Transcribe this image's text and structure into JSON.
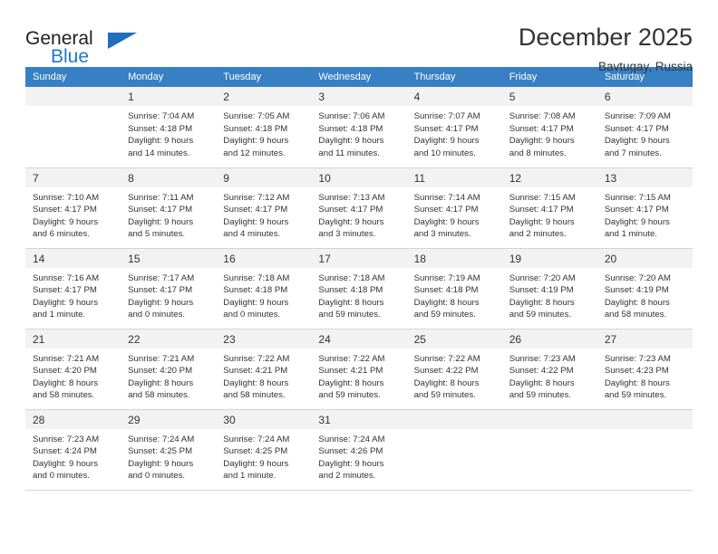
{
  "logo": {
    "text_top": "General",
    "text_bottom": "Blue",
    "flag_icon": "triangle-flag-icon",
    "color_primary": "#2079c7",
    "color_dark": "#231f20"
  },
  "header": {
    "title": "December 2025",
    "subtitle": "Bavtugay, Russia"
  },
  "calendar": {
    "header_bg": "#3880c4",
    "daynum_bg": "#f2f2f2",
    "weekdays": [
      "Sunday",
      "Monday",
      "Tuesday",
      "Wednesday",
      "Thursday",
      "Friday",
      "Saturday"
    ],
    "weeks": [
      [
        {
          "day": "",
          "empty": true,
          "sunrise": "",
          "sunset": "",
          "daylight_line1": "",
          "daylight_line2": ""
        },
        {
          "day": "1",
          "empty": false,
          "sunrise": "Sunrise: 7:04 AM",
          "sunset": "Sunset: 4:18 PM",
          "daylight_line1": "Daylight: 9 hours",
          "daylight_line2": "and 14 minutes."
        },
        {
          "day": "2",
          "empty": false,
          "sunrise": "Sunrise: 7:05 AM",
          "sunset": "Sunset: 4:18 PM",
          "daylight_line1": "Daylight: 9 hours",
          "daylight_line2": "and 12 minutes."
        },
        {
          "day": "3",
          "empty": false,
          "sunrise": "Sunrise: 7:06 AM",
          "sunset": "Sunset: 4:18 PM",
          "daylight_line1": "Daylight: 9 hours",
          "daylight_line2": "and 11 minutes."
        },
        {
          "day": "4",
          "empty": false,
          "sunrise": "Sunrise: 7:07 AM",
          "sunset": "Sunset: 4:17 PM",
          "daylight_line1": "Daylight: 9 hours",
          "daylight_line2": "and 10 minutes."
        },
        {
          "day": "5",
          "empty": false,
          "sunrise": "Sunrise: 7:08 AM",
          "sunset": "Sunset: 4:17 PM",
          "daylight_line1": "Daylight: 9 hours",
          "daylight_line2": "and 8 minutes."
        },
        {
          "day": "6",
          "empty": false,
          "sunrise": "Sunrise: 7:09 AM",
          "sunset": "Sunset: 4:17 PM",
          "daylight_line1": "Daylight: 9 hours",
          "daylight_line2": "and 7 minutes."
        }
      ],
      [
        {
          "day": "7",
          "empty": false,
          "sunrise": "Sunrise: 7:10 AM",
          "sunset": "Sunset: 4:17 PM",
          "daylight_line1": "Daylight: 9 hours",
          "daylight_line2": "and 6 minutes."
        },
        {
          "day": "8",
          "empty": false,
          "sunrise": "Sunrise: 7:11 AM",
          "sunset": "Sunset: 4:17 PM",
          "daylight_line1": "Daylight: 9 hours",
          "daylight_line2": "and 5 minutes."
        },
        {
          "day": "9",
          "empty": false,
          "sunrise": "Sunrise: 7:12 AM",
          "sunset": "Sunset: 4:17 PM",
          "daylight_line1": "Daylight: 9 hours",
          "daylight_line2": "and 4 minutes."
        },
        {
          "day": "10",
          "empty": false,
          "sunrise": "Sunrise: 7:13 AM",
          "sunset": "Sunset: 4:17 PM",
          "daylight_line1": "Daylight: 9 hours",
          "daylight_line2": "and 3 minutes."
        },
        {
          "day": "11",
          "empty": false,
          "sunrise": "Sunrise: 7:14 AM",
          "sunset": "Sunset: 4:17 PM",
          "daylight_line1": "Daylight: 9 hours",
          "daylight_line2": "and 3 minutes."
        },
        {
          "day": "12",
          "empty": false,
          "sunrise": "Sunrise: 7:15 AM",
          "sunset": "Sunset: 4:17 PM",
          "daylight_line1": "Daylight: 9 hours",
          "daylight_line2": "and 2 minutes."
        },
        {
          "day": "13",
          "empty": false,
          "sunrise": "Sunrise: 7:15 AM",
          "sunset": "Sunset: 4:17 PM",
          "daylight_line1": "Daylight: 9 hours",
          "daylight_line2": "and 1 minute."
        }
      ],
      [
        {
          "day": "14",
          "empty": false,
          "sunrise": "Sunrise: 7:16 AM",
          "sunset": "Sunset: 4:17 PM",
          "daylight_line1": "Daylight: 9 hours",
          "daylight_line2": "and 1 minute."
        },
        {
          "day": "15",
          "empty": false,
          "sunrise": "Sunrise: 7:17 AM",
          "sunset": "Sunset: 4:17 PM",
          "daylight_line1": "Daylight: 9 hours",
          "daylight_line2": "and 0 minutes."
        },
        {
          "day": "16",
          "empty": false,
          "sunrise": "Sunrise: 7:18 AM",
          "sunset": "Sunset: 4:18 PM",
          "daylight_line1": "Daylight: 9 hours",
          "daylight_line2": "and 0 minutes."
        },
        {
          "day": "17",
          "empty": false,
          "sunrise": "Sunrise: 7:18 AM",
          "sunset": "Sunset: 4:18 PM",
          "daylight_line1": "Daylight: 8 hours",
          "daylight_line2": "and 59 minutes."
        },
        {
          "day": "18",
          "empty": false,
          "sunrise": "Sunrise: 7:19 AM",
          "sunset": "Sunset: 4:18 PM",
          "daylight_line1": "Daylight: 8 hours",
          "daylight_line2": "and 59 minutes."
        },
        {
          "day": "19",
          "empty": false,
          "sunrise": "Sunrise: 7:20 AM",
          "sunset": "Sunset: 4:19 PM",
          "daylight_line1": "Daylight: 8 hours",
          "daylight_line2": "and 59 minutes."
        },
        {
          "day": "20",
          "empty": false,
          "sunrise": "Sunrise: 7:20 AM",
          "sunset": "Sunset: 4:19 PM",
          "daylight_line1": "Daylight: 8 hours",
          "daylight_line2": "and 58 minutes."
        }
      ],
      [
        {
          "day": "21",
          "empty": false,
          "sunrise": "Sunrise: 7:21 AM",
          "sunset": "Sunset: 4:20 PM",
          "daylight_line1": "Daylight: 8 hours",
          "daylight_line2": "and 58 minutes."
        },
        {
          "day": "22",
          "empty": false,
          "sunrise": "Sunrise: 7:21 AM",
          "sunset": "Sunset: 4:20 PM",
          "daylight_line1": "Daylight: 8 hours",
          "daylight_line2": "and 58 minutes."
        },
        {
          "day": "23",
          "empty": false,
          "sunrise": "Sunrise: 7:22 AM",
          "sunset": "Sunset: 4:21 PM",
          "daylight_line1": "Daylight: 8 hours",
          "daylight_line2": "and 58 minutes."
        },
        {
          "day": "24",
          "empty": false,
          "sunrise": "Sunrise: 7:22 AM",
          "sunset": "Sunset: 4:21 PM",
          "daylight_line1": "Daylight: 8 hours",
          "daylight_line2": "and 59 minutes."
        },
        {
          "day": "25",
          "empty": false,
          "sunrise": "Sunrise: 7:22 AM",
          "sunset": "Sunset: 4:22 PM",
          "daylight_line1": "Daylight: 8 hours",
          "daylight_line2": "and 59 minutes."
        },
        {
          "day": "26",
          "empty": false,
          "sunrise": "Sunrise: 7:23 AM",
          "sunset": "Sunset: 4:22 PM",
          "daylight_line1": "Daylight: 8 hours",
          "daylight_line2": "and 59 minutes."
        },
        {
          "day": "27",
          "empty": false,
          "sunrise": "Sunrise: 7:23 AM",
          "sunset": "Sunset: 4:23 PM",
          "daylight_line1": "Daylight: 8 hours",
          "daylight_line2": "and 59 minutes."
        }
      ],
      [
        {
          "day": "28",
          "empty": false,
          "sunrise": "Sunrise: 7:23 AM",
          "sunset": "Sunset: 4:24 PM",
          "daylight_line1": "Daylight: 9 hours",
          "daylight_line2": "and 0 minutes."
        },
        {
          "day": "29",
          "empty": false,
          "sunrise": "Sunrise: 7:24 AM",
          "sunset": "Sunset: 4:25 PM",
          "daylight_line1": "Daylight: 9 hours",
          "daylight_line2": "and 0 minutes."
        },
        {
          "day": "30",
          "empty": false,
          "sunrise": "Sunrise: 7:24 AM",
          "sunset": "Sunset: 4:25 PM",
          "daylight_line1": "Daylight: 9 hours",
          "daylight_line2": "and 1 minute."
        },
        {
          "day": "31",
          "empty": false,
          "sunrise": "Sunrise: 7:24 AM",
          "sunset": "Sunset: 4:26 PM",
          "daylight_line1": "Daylight: 9 hours",
          "daylight_line2": "and 2 minutes."
        },
        {
          "day": "",
          "empty": true,
          "sunrise": "",
          "sunset": "",
          "daylight_line1": "",
          "daylight_line2": ""
        },
        {
          "day": "",
          "empty": true,
          "sunrise": "",
          "sunset": "",
          "daylight_line1": "",
          "daylight_line2": ""
        },
        {
          "day": "",
          "empty": true,
          "sunrise": "",
          "sunset": "",
          "daylight_line1": "",
          "daylight_line2": ""
        }
      ]
    ]
  }
}
